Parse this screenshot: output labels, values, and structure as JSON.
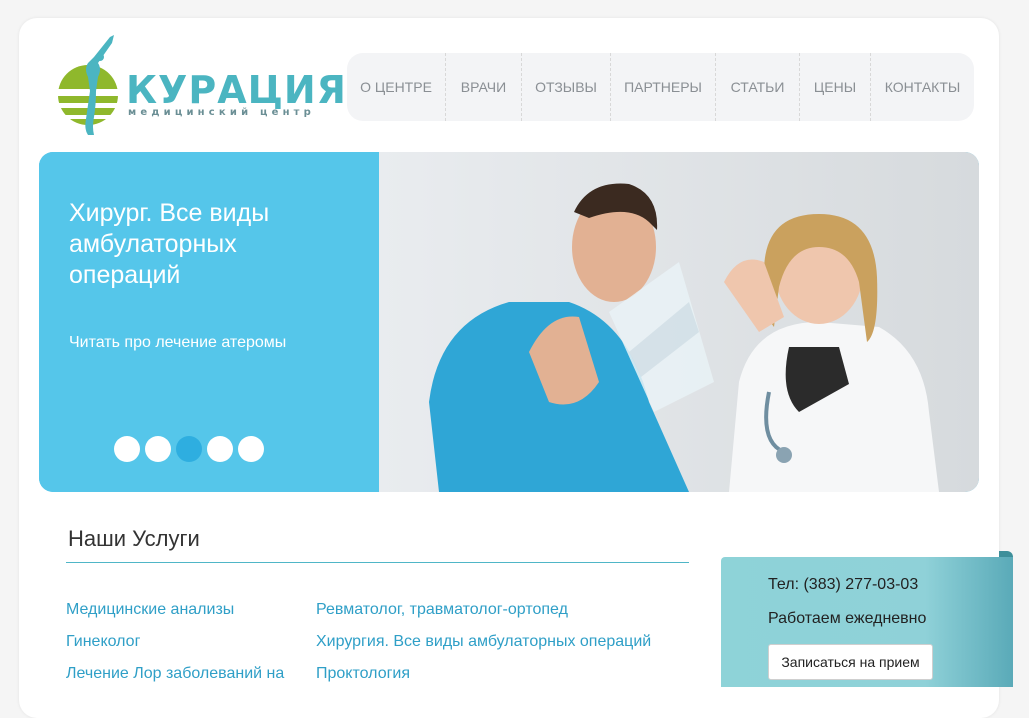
{
  "header": {
    "logo_text": "КУРАЦИЯ",
    "logo_subtitle": "медицинский центр",
    "nav": [
      {
        "label": "О ЦЕНТРЕ"
      },
      {
        "label": "ВРАЧИ"
      },
      {
        "label": "ОТЗЫВЫ"
      },
      {
        "label": "ПАРТНЕРЫ"
      },
      {
        "label": "СТАТЬИ"
      },
      {
        "label": "ЦЕНЫ"
      },
      {
        "label": "КОНТАКТЫ"
      }
    ]
  },
  "slider": {
    "title": "Хирург. Все виды амбулаторных операций",
    "link": "Читать про лечение атеромы",
    "dot_count": 5,
    "active_dot": 3
  },
  "services": {
    "title": "Наши Услуги",
    "items": [
      "Медицинские анализы",
      "Ревматолог, травматолог-ортопед",
      "Гинеколог",
      "Хирургия. Все виды амбулаторных операций",
      "Лечение Лор заболеваний на",
      "Проктология"
    ]
  },
  "contact": {
    "phone": "Тел: (383) 277-03-03",
    "hours": "Работаем ежедневно",
    "button": "Записаться на прием"
  },
  "colors": {
    "accent": "#4bb5c1",
    "slider_panel": "#55c6ea",
    "link": "#2f9fc7",
    "active_dot": "#2eaee0"
  }
}
